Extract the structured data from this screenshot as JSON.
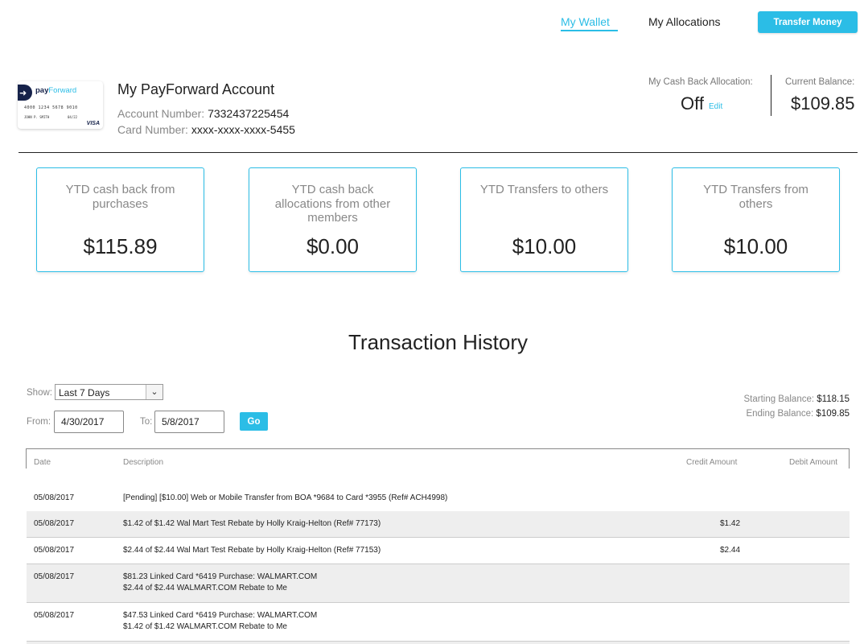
{
  "nav": {
    "my_wallet": "My Wallet",
    "my_allocations": "My Allocations",
    "transfer_money": "Transfer Money"
  },
  "card": {
    "brand_pay": "pay",
    "brand_forward": "Forward",
    "number": "4000 1234 5678 9010",
    "name": "JOHN P. SMITH",
    "expiry": "04/22",
    "network": "VISA"
  },
  "account": {
    "title": "My PayForward Account",
    "account_number_label": "Account Number:",
    "account_number": "7332437225454",
    "card_number_label": "Card Number:",
    "card_number": "xxxx-xxxx-xxxx-5455"
  },
  "cash_back": {
    "label": "My Cash Back Allocation:",
    "value": "Off",
    "edit": "Edit"
  },
  "balance": {
    "label": "Current Balance:",
    "value": "$109.85"
  },
  "stats": [
    {
      "label": "YTD cash back from purchases",
      "value": "$115.89"
    },
    {
      "label": "YTD cash back allocations from other members",
      "value": "$0.00"
    },
    {
      "label": "YTD Transfers to others",
      "value": "$10.00"
    },
    {
      "label": "YTD Transfers from others",
      "value": "$10.00"
    }
  ],
  "history": {
    "title": "Transaction History",
    "show_label": "Show:",
    "show_value": "Last 7 Days",
    "from_label": "From:",
    "from_value": "4/30/2017",
    "to_label": "To:",
    "to_value": "5/8/2017",
    "go": "Go",
    "starting_balance_label": "Starting Balance:",
    "starting_balance": "$118.15",
    "ending_balance_label": "Ending Balance:",
    "ending_balance": "$109.85",
    "columns": [
      "Date",
      "Description",
      "Credit Amount",
      "Debit Amount"
    ],
    "rows": [
      {
        "date": "05/08/2017",
        "desc": [
          "[Pending] [$10.00] Web or Mobile Transfer from BOA *9684 to Card *3955 (Ref# ACH4998)"
        ],
        "credit": "",
        "debit": ""
      },
      {
        "date": "05/08/2017",
        "desc": [
          "$1.42 of $1.42 Wal Mart Test Rebate by Holly Kraig-Helton (Ref# 77173)"
        ],
        "credit": "$1.42",
        "debit": ""
      },
      {
        "date": "05/08/2017",
        "desc": [
          "$2.44 of $2.44 Wal Mart Test Rebate by Holly Kraig-Helton (Ref# 77153)"
        ],
        "credit": "$2.44",
        "debit": ""
      },
      {
        "date": "05/08/2017",
        "desc": [
          "$81.23 Linked Card *6419 Purchase: WALMART.COM",
          "$2.44 of $2.44 WALMART.COM Rebate to Me"
        ],
        "credit": "",
        "debit": ""
      },
      {
        "date": "05/08/2017",
        "desc": [
          "$47.53 Linked Card *6419 Purchase: WALMART.COM",
          "$1.42 of $1.42 WALMART.COM Rebate to Me"
        ],
        "credit": "",
        "debit": ""
      }
    ]
  }
}
